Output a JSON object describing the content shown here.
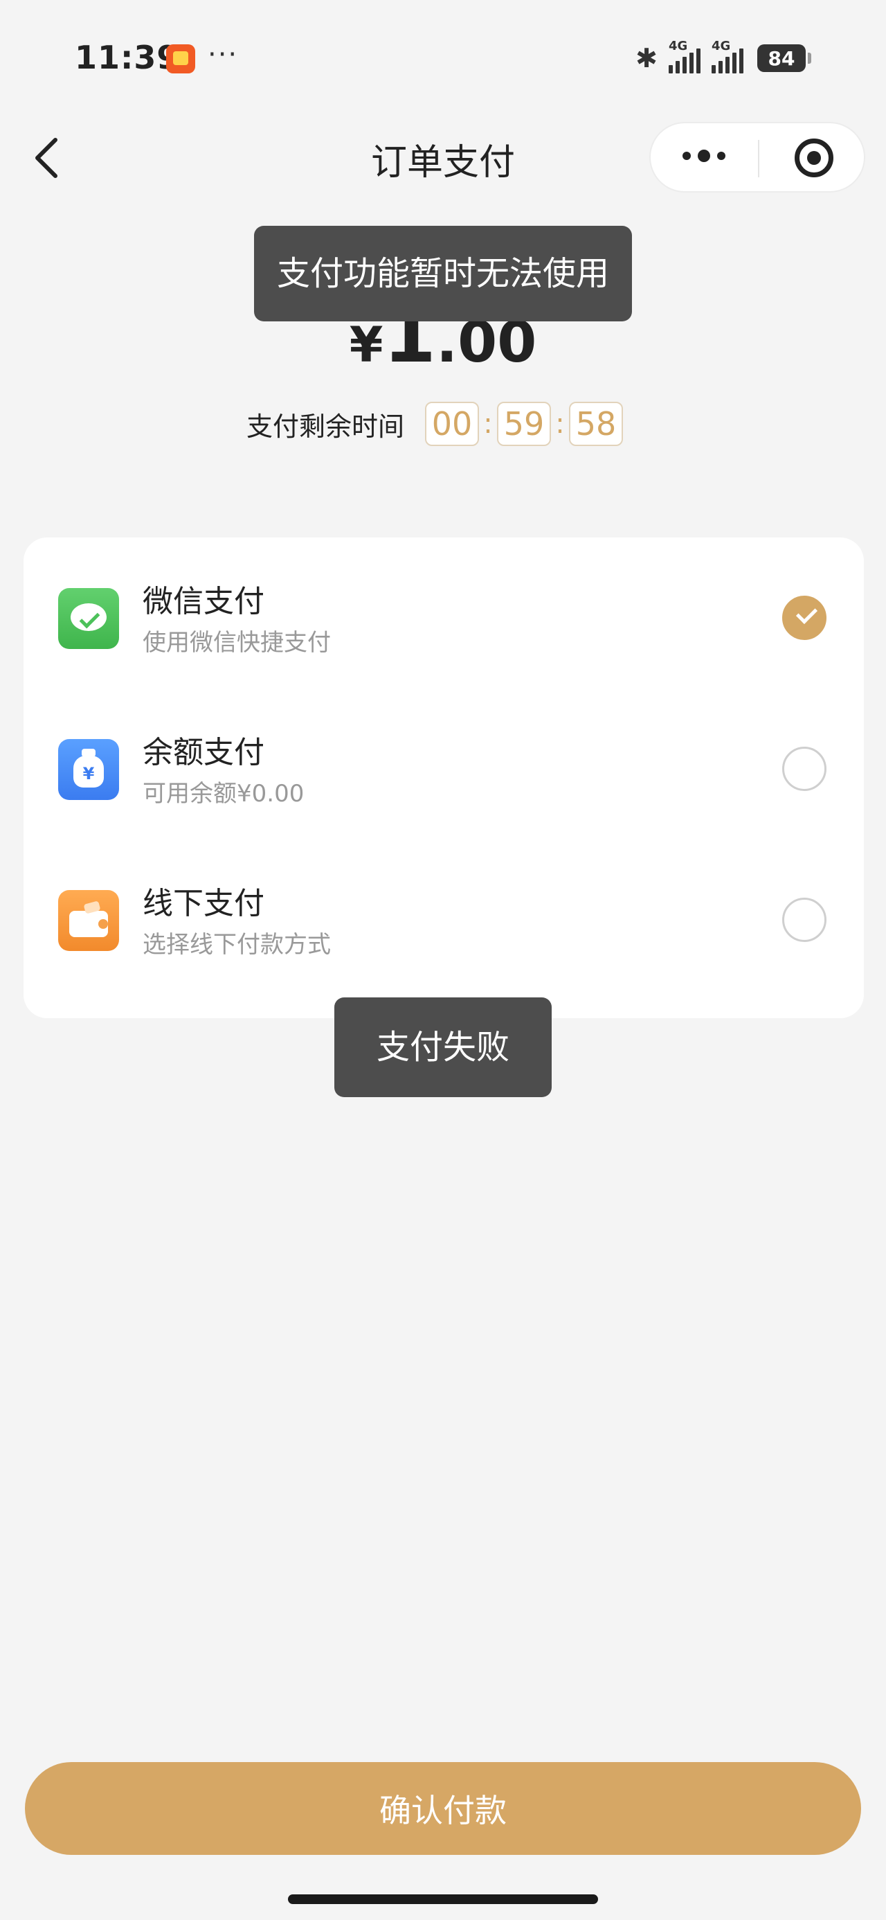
{
  "status_bar": {
    "time": "11:39",
    "dots": "···",
    "network1": "4G",
    "network2": "4G",
    "battery": "84"
  },
  "nav": {
    "title": "订单支付"
  },
  "amount": {
    "currency": "¥",
    "integer": "1",
    "decimal": ".00"
  },
  "countdown": {
    "label": "支付剩余时间",
    "hours": "00",
    "minutes": "59",
    "seconds": "58",
    "separator": ":"
  },
  "payment_methods": [
    {
      "title": "微信支付",
      "subtitle": "使用微信快捷支付",
      "selected": true
    },
    {
      "title": "余额支付",
      "subtitle": "可用余额¥0.00",
      "selected": false
    },
    {
      "title": "线下支付",
      "subtitle": "选择线下付款方式",
      "selected": false
    }
  ],
  "toasts": {
    "top": "支付功能暂时无法使用",
    "middle": "支付失败"
  },
  "confirm_button": {
    "label": "确认付款"
  },
  "colors": {
    "accent": "#d6a765",
    "toast_bg": "#4d4d4d",
    "page_bg": "#f4f4f4"
  }
}
